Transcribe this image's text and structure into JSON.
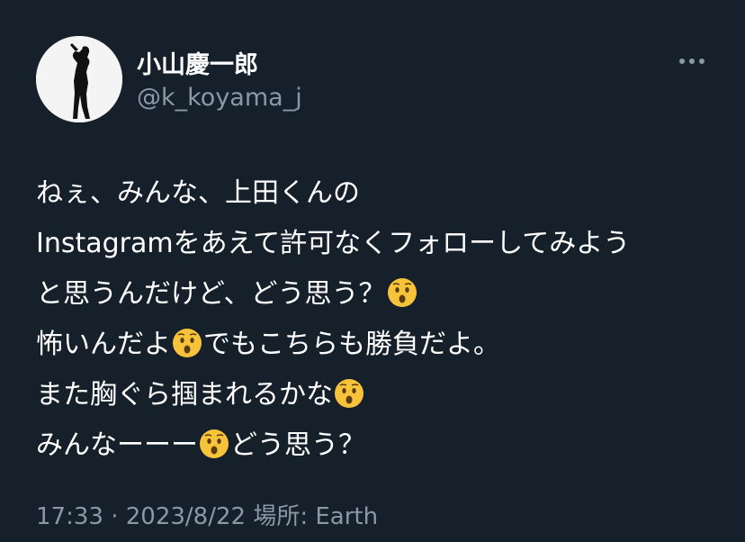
{
  "user": {
    "display_name": "小山慶一郎",
    "handle": "@k_koyama_j",
    "avatar_icon": "profile-silhouette-photo"
  },
  "menu": {
    "more_icon": "ellipsis-icon"
  },
  "tweet": {
    "lines": [
      {
        "parts": [
          "ねぇ、みんな、上田くんの"
        ]
      },
      {
        "parts": [
          "Instagramをあえて許可なくフォローしてみよう"
        ]
      },
      {
        "parts": [
          "と思うんだけど、どう思う？",
          ""
        ]
      },
      {
        "parts": [
          "怖いんだよ",
          "でもこちらも勝負だよ。"
        ]
      },
      {
        "parts": [
          "また胸ぐら掴まれるかな",
          ""
        ]
      },
      {
        "parts": [
          "みんなーーー",
          "どう思う？"
        ]
      }
    ],
    "emoji_icon": "hushed-face-emoji"
  },
  "footer": {
    "time": "17:33",
    "separator": "·",
    "date": "2023/8/22",
    "location_label": "場所:",
    "location": "Earth"
  },
  "colors": {
    "background": "#15202b",
    "text_primary": "#ffffff",
    "text_secondary": "#8b98a5",
    "emoji_face": "#f7c33b"
  }
}
